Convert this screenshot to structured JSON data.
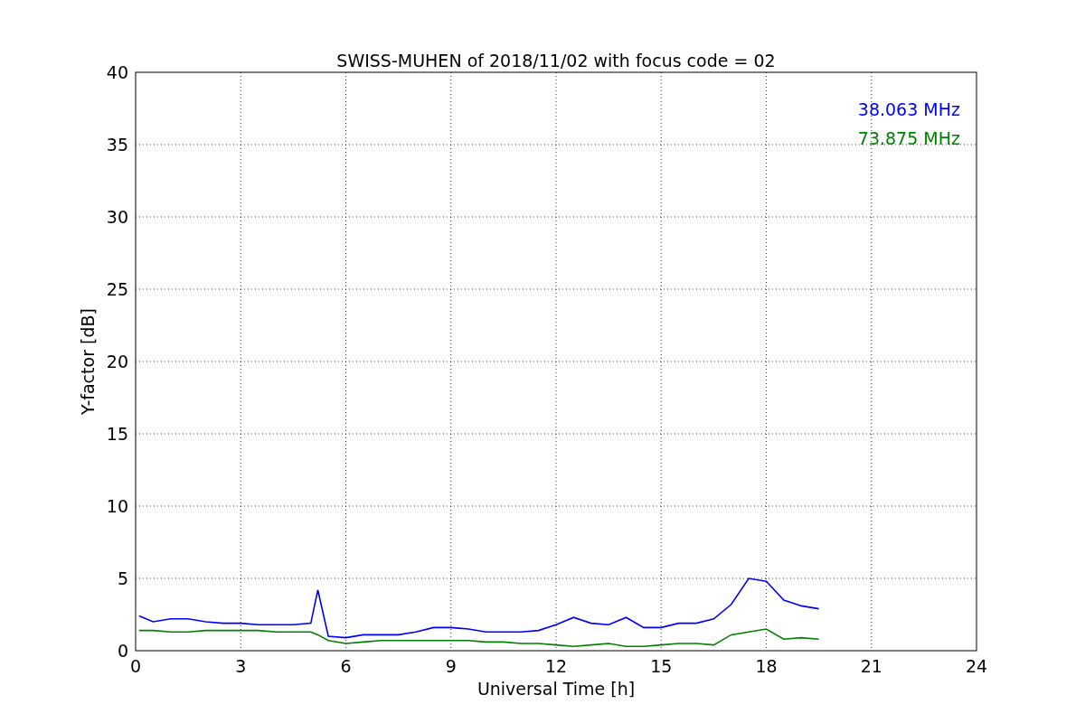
{
  "figure": {
    "chart_data": {
      "type": "line",
      "title": "SWISS-MUHEN of 2018/11/02 with focus code = 02",
      "xlabel": "Universal Time [h]",
      "ylabel": "Y-factor [dB]",
      "x": [
        0.1,
        0.5,
        1,
        1.5,
        2,
        2.5,
        3,
        3.5,
        4,
        4.5,
        5,
        5.2,
        5.5,
        6,
        6.5,
        7,
        7.5,
        8,
        8.5,
        9,
        9.5,
        10,
        10.5,
        11,
        11.5,
        12,
        12.5,
        13,
        13.5,
        14,
        14.5,
        15,
        15.5,
        16,
        16.5,
        17,
        17.5,
        18,
        18.5,
        19,
        19.5
      ],
      "series": [
        {
          "name": "38.063 MHz",
          "color": "#0000ff",
          "values": [
            2.4,
            2.0,
            2.2,
            2.2,
            2.0,
            1.9,
            1.9,
            1.8,
            1.8,
            1.8,
            1.9,
            4.2,
            1.0,
            0.9,
            1.1,
            1.1,
            1.1,
            1.3,
            1.6,
            1.6,
            1.5,
            1.3,
            1.3,
            1.3,
            1.4,
            1.8,
            2.3,
            1.9,
            1.8,
            2.3,
            1.6,
            1.6,
            1.9,
            1.9,
            2.2,
            3.2,
            5.0,
            4.8,
            3.5,
            3.1,
            2.9
          ]
        },
        {
          "name": "73.875 MHz",
          "color": "#008000",
          "values": [
            1.4,
            1.4,
            1.3,
            1.3,
            1.4,
            1.4,
            1.4,
            1.4,
            1.3,
            1.3,
            1.3,
            1.1,
            0.7,
            0.5,
            0.6,
            0.7,
            0.7,
            0.7,
            0.7,
            0.7,
            0.7,
            0.6,
            0.6,
            0.5,
            0.5,
            0.4,
            0.3,
            0.4,
            0.5,
            0.3,
            0.3,
            0.4,
            0.5,
            0.5,
            0.4,
            1.1,
            1.3,
            1.5,
            0.8,
            0.9,
            0.8
          ]
        }
      ],
      "xlim": [
        0,
        24
      ],
      "ylim": [
        0,
        40
      ],
      "xticks": [
        0,
        3,
        6,
        9,
        12,
        15,
        18,
        21,
        24
      ],
      "yticks": [
        0,
        5,
        10,
        15,
        20,
        25,
        30,
        35,
        40
      ],
      "grid": true
    }
  }
}
